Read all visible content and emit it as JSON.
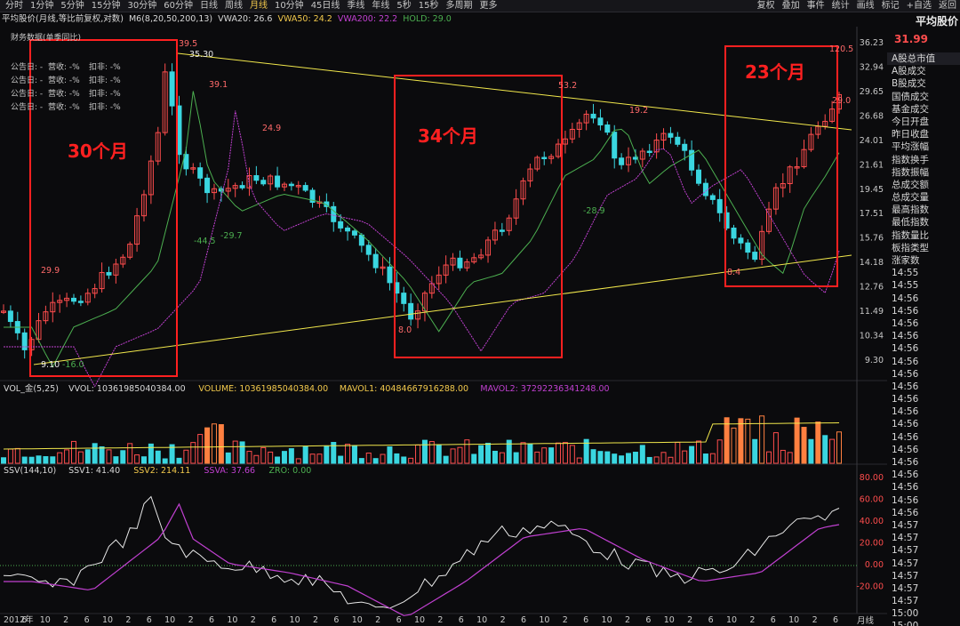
{
  "top_tabs": [
    "分时",
    "1分钟",
    "5分钟",
    "15分钟",
    "30分钟",
    "60分钟",
    "日线",
    "周线",
    "月线",
    "10分钟",
    "45日线",
    "季线",
    "年线",
    "5秒",
    "15秒",
    "多周期",
    "更多"
  ],
  "top_tabs_active": "月线",
  "right_tools": [
    "复权",
    "叠加",
    "事件",
    "统计",
    "画线",
    "标记",
    "+自选",
    "返回"
  ],
  "info_line": [
    {
      "text": "平均股价(月线,等比前复权,对数)",
      "color": "#d8d8d8"
    },
    {
      "text": "M6(8,20,50,200,13)",
      "color": "#d8d8d8"
    },
    {
      "text": "VWA20: 26.6",
      "color": "#d8d8d8"
    },
    {
      "text": "VWA50: 24.2",
      "color": "#f2c94c"
    },
    {
      "text": "VWA200: 22.2",
      "color": "#c040d0"
    },
    {
      "text": "HOLD: 29.0",
      "color": "#4caf50"
    }
  ],
  "finance_title": "财务数据(单季同比)",
  "finance_rows": [
    {
      "a": "公告日: -",
      "b": "营收: -%",
      "c": "扣非: -%"
    },
    {
      "a": "公告日: -",
      "b": "营收: -%",
      "c": "扣非: -%"
    },
    {
      "a": "公告日: -",
      "b": "营收: -%",
      "c": "扣非: -%"
    },
    {
      "a": "公告日: -",
      "b": "营收: -%",
      "c": "扣非: -%"
    }
  ],
  "boxes": [
    {
      "label": "30个月"
    },
    {
      "label": "34个月"
    },
    {
      "label": "23个月"
    }
  ],
  "price_labels": [
    "9.10",
    "-16.0",
    "29.9",
    "39.5",
    "35.30",
    "39.1",
    "-44.5",
    "-29.7",
    "24.9",
    "8.0",
    "53.2",
    "19.2",
    "-28.9",
    "8.4",
    "120.5",
    "29.0"
  ],
  "price_axis": [
    "36.23",
    "32.94",
    "29.65",
    "26.68",
    "24.01",
    "21.61",
    "19.45",
    "17.51",
    "15.76",
    "14.18",
    "12.76",
    "11.49",
    "10.34",
    "9.30"
  ],
  "vol_info": [
    {
      "text": "VOL_金(5,25)",
      "color": "#d8d8d8"
    },
    {
      "text": "VVOL: 10361985040384.00",
      "color": "#d8d8d8"
    },
    {
      "text": "VOLUME: 10361985040384.00",
      "color": "#f2c94c"
    },
    {
      "text": "MAVOL1: 40484667916288.00",
      "color": "#f2c94c"
    },
    {
      "text": "MAVOL2: 37292236341248.00",
      "color": "#c040d0"
    }
  ],
  "ssv_info": [
    {
      "text": "SSV(144,10)",
      "color": "#d8d8d8"
    },
    {
      "text": "SSV1: 41.40",
      "color": "#d8d8d8"
    },
    {
      "text": "SSV2: 214.11",
      "color": "#f2c94c"
    },
    {
      "text": "SSVA: 37.66",
      "color": "#c040d0"
    },
    {
      "text": "ZRO: 0.00",
      "color": "#4caf50"
    }
  ],
  "ssv_axis": [
    "80.00",
    "60.00",
    "40.00",
    "20.00",
    "0.00",
    "-20.00"
  ],
  "x_axis": [
    "2012年",
    "6",
    "10",
    "2",
    "6",
    "10",
    "2",
    "6",
    "10",
    "2",
    "6",
    "10",
    "2",
    "6",
    "10",
    "2",
    "6",
    "10",
    "2",
    "6",
    "10",
    "2",
    "6",
    "10",
    "2",
    "6",
    "10",
    "2",
    "6",
    "10",
    "2",
    "6",
    "10",
    "2",
    "6",
    "10",
    "2",
    "6",
    "10",
    "2",
    "6"
  ],
  "x_axis_end": "月线",
  "sidebar": {
    "title": "平均股价",
    "price": "31.99",
    "items": [
      "A股总市值",
      "A股成交",
      "B股成交",
      "国债成交",
      "基金成交",
      "今日开盘",
      "昨日收盘",
      "平均涨幅",
      "指数换手",
      "指数振幅",
      "总成交额",
      "总成交量",
      "最高指数",
      "最低指数",
      "指数量比",
      "板指类型",
      "涨家数",
      "14:55",
      "14:55",
      "14:56",
      "14:56",
      "14:56",
      "14:56",
      "14:56",
      "14:56",
      "14:56",
      "14:56",
      "14:56",
      "14:56",
      "14:56",
      "14:56",
      "14:56",
      "14:56",
      "14:56",
      "14:56",
      "14:56",
      "14:56",
      "14:57",
      "14:57",
      "14:57",
      "14:57",
      "14:57",
      "14:57",
      "14:57",
      "15:00",
      "15:00",
      "15:00"
    ]
  },
  "colors": {
    "up": "#ff4d4d",
    "down": "#3ad6e0",
    "accent": "#ff2020",
    "yellow": "#f2e84c",
    "purple": "#c040d0",
    "green": "#4caf50"
  }
}
